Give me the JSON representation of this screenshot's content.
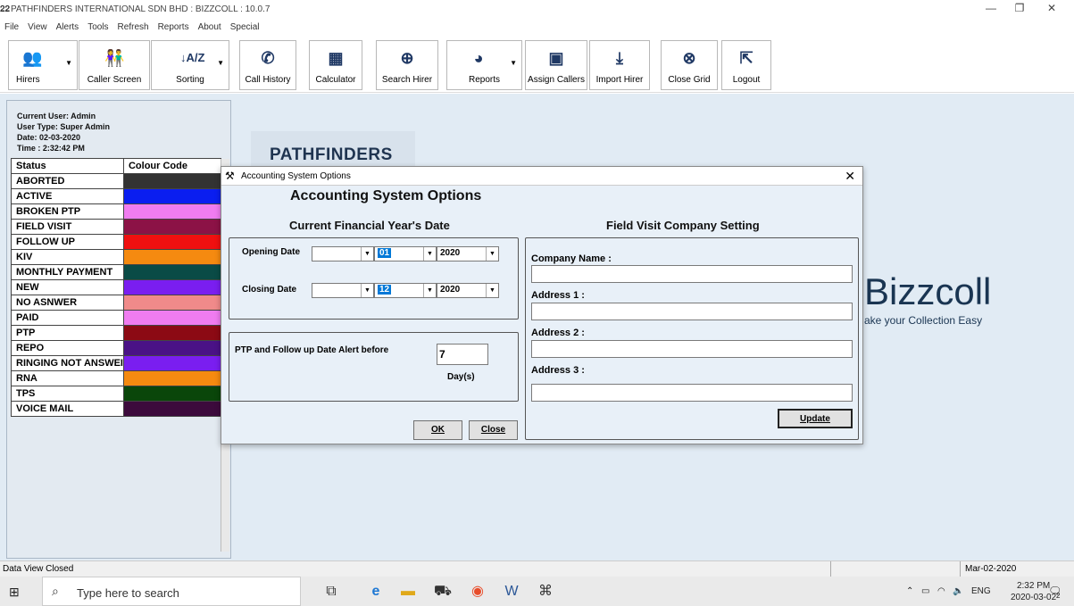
{
  "window": {
    "title": "PATHFINDERS INTERNATIONAL SDN BHD : BIZZCOLL : 10.0.7",
    "app_icon": "app-icon",
    "minimize": "—",
    "restore": "❐",
    "close": "✕"
  },
  "menu": [
    "File",
    "View",
    "Alerts",
    "Tools",
    "Refresh",
    "Reports",
    "About",
    "Special"
  ],
  "toolbar": {
    "hirers": "Hirers",
    "caller_screen": "Caller Screen",
    "sorting": "Sorting",
    "call_history": "Call History",
    "calculator": "Calculator",
    "search_hirer": "Search Hirer",
    "reports": "Reports",
    "assign_callers": "Assign Callers",
    "import_hirer": "Import Hirer",
    "close_grid": "Close Grid",
    "logout": "Logout"
  },
  "user_info": {
    "current_user": "Current User: Admin",
    "user_type": "User Type: Super Admin",
    "date": "Date: 02-03-2020",
    "time": "Time : 2:32:42 PM"
  },
  "status_table": {
    "headers": [
      "Status",
      "Colour Code"
    ],
    "rows": [
      {
        "status": "ABORTED",
        "color": "#333333"
      },
      {
        "status": "ACTIVE",
        "color": "#0a1ef0"
      },
      {
        "status": "BROKEN PTP",
        "color": "#f07cf0"
      },
      {
        "status": "FIELD VISIT",
        "color": "#8c1246"
      },
      {
        "status": "FOLLOW UP",
        "color": "#f01010"
      },
      {
        "status": "KIV",
        "color": "#f58a10"
      },
      {
        "status": "MONTHLY PAYMENT",
        "color": "#0a4b46"
      },
      {
        "status": "NEW",
        "color": "#7a1ef0"
      },
      {
        "status": "NO ASNWER",
        "color": "#f08a8a"
      },
      {
        "status": "PAID",
        "color": "#f07cf0"
      },
      {
        "status": "PTP",
        "color": "#8c0a14"
      },
      {
        "status": "REPO",
        "color": "#4a1286"
      },
      {
        "status": "RINGING NOT ANSWEI",
        "color": "#7a1ef0"
      },
      {
        "status": "RNA",
        "color": "#f58a10"
      },
      {
        "status": "TPS",
        "color": "#0a460a"
      },
      {
        "status": "VOICE MAIL",
        "color": "#3c0a3c"
      }
    ]
  },
  "background": {
    "card_title": "PATHFINDERS",
    "brand": "Bizzcoll",
    "tagline": "ake your Collection Easy"
  },
  "dialog": {
    "title": "Accounting System Options",
    "heading": "Accounting System Options",
    "financial_title": "Current Financial Year's Date",
    "field_title": "Field Visit Company Setting",
    "opening_label": "Opening Date",
    "opening_day": "",
    "opening_month": "01",
    "opening_year": "2020",
    "closing_label": "Closing Date",
    "closing_day": "",
    "closing_month": "12",
    "closing_year": "2020",
    "alert_label": "PTP and Follow up Date Alert before",
    "alert_value": "7",
    "alert_unit": "Day(s)",
    "ok": "OK",
    "close": "Close",
    "company_label": "Company Name :",
    "address1_label": "Address 1 :",
    "address2_label": "Address 2 :",
    "address3_label": "Address 3 :",
    "company_value": "",
    "address1_value": "",
    "address2_value": "",
    "address3_value": "",
    "update": "Update"
  },
  "statusbar": {
    "message": "Data View Closed",
    "date": "Mar-02-2020"
  },
  "taskbar": {
    "search_placeholder": "Type here to search",
    "lang": "ENG",
    "time": "2:32 PM",
    "date": "2020-03-02",
    "notifications": "2"
  }
}
